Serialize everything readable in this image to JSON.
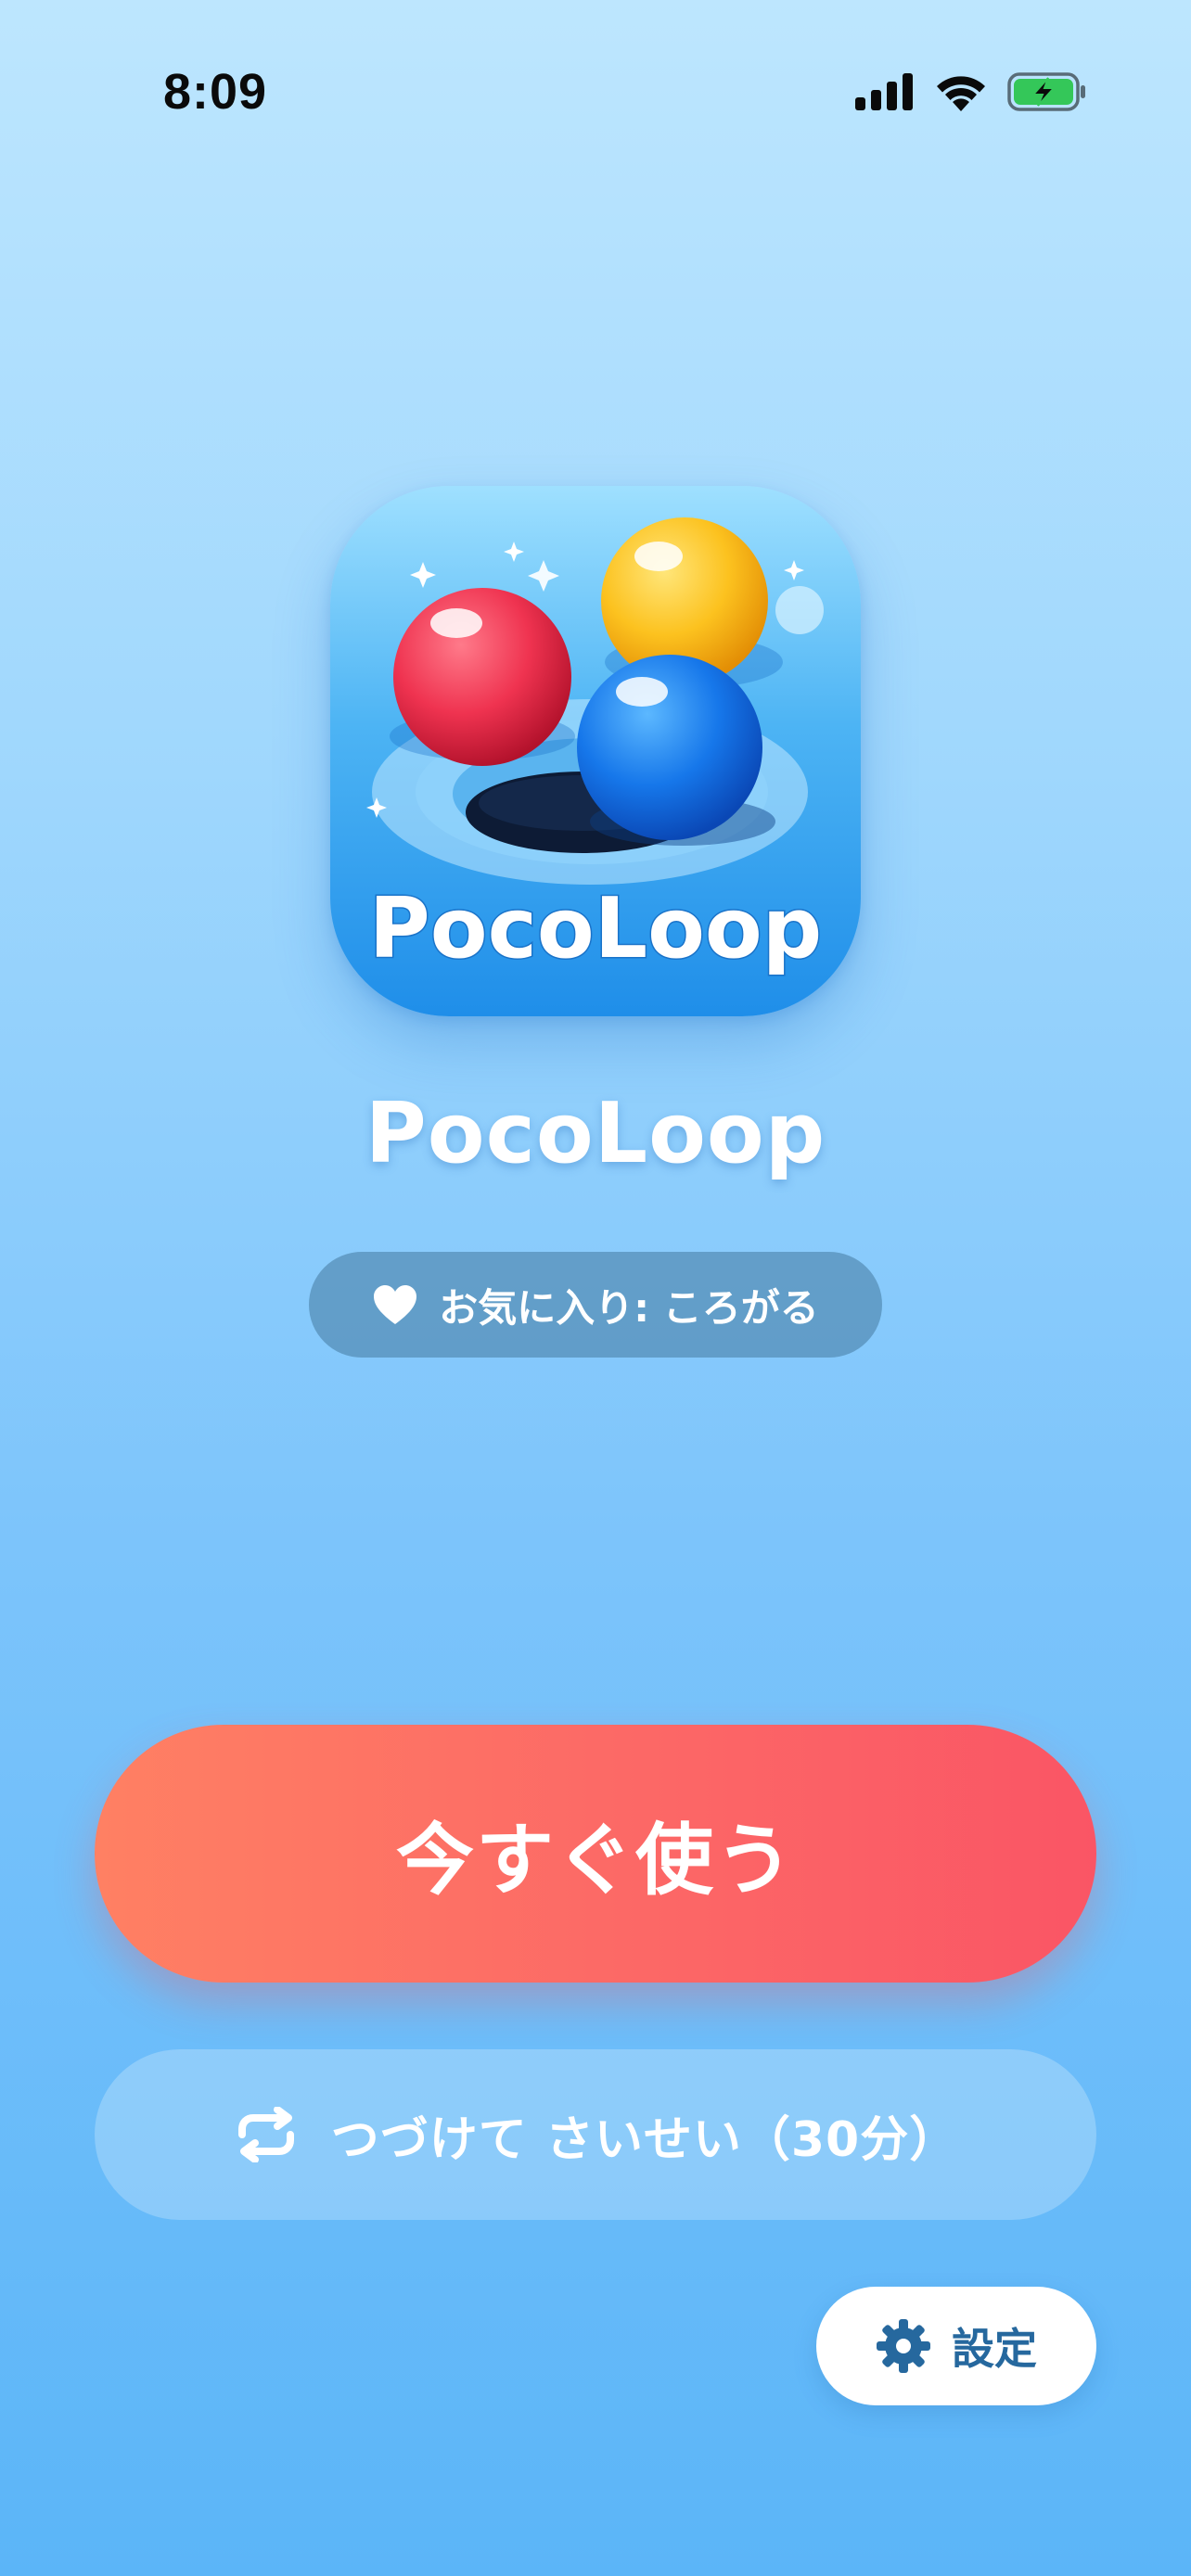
{
  "status_bar": {
    "time": "8:09",
    "signal_icon": "cellular-signal-icon",
    "wifi_icon": "wifi-icon",
    "battery_icon": "battery-charging-icon",
    "battery_color": "#34c759"
  },
  "app": {
    "icon_name": "pocoloop-app-icon",
    "icon_text": "PocoLoop",
    "title": "PocoLoop"
  },
  "favorite": {
    "icon": "heart-icon",
    "label": "お気に入り: ころがる"
  },
  "actions": {
    "primary_label": "今すぐ使う",
    "secondary_icon": "repeat-icon",
    "secondary_label": "つづけて さいせい（30分）",
    "settings_icon": "gear-icon",
    "settings_label": "設定"
  },
  "colors": {
    "background_top": "#bde6fe",
    "background_bottom": "#5bb5f8",
    "primary_start": "#ff8063",
    "primary_end": "#fa5565",
    "settings_text": "#26689e"
  }
}
